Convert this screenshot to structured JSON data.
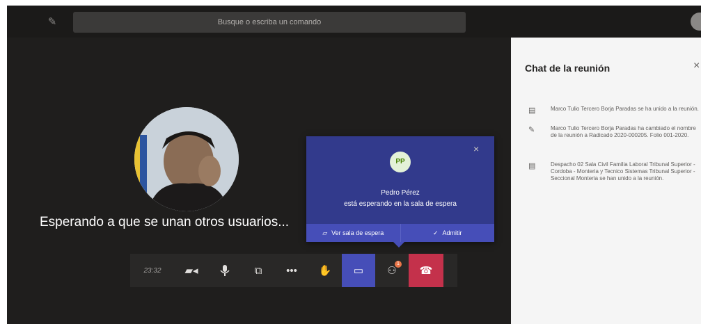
{
  "header": {
    "compose_icon": "compose-icon",
    "search_placeholder": "Busque o escriba un comando"
  },
  "stage": {
    "waiting_text": "Esperando a que se unan otros usuarios..."
  },
  "chat": {
    "title": "Chat de la reunión",
    "close_icon": "×",
    "messages": [
      {
        "icon": "people-icon",
        "text": "Marco Tulio Tercero Borja Paradas se ha unido a la reunión."
      },
      {
        "icon": "pencil-icon",
        "text": "Marco Tulio Tercero Borja Paradas ha cambiado el nombre de la reunión a Radicado 2020-000205. Folio 001-2020."
      },
      {
        "icon": "people-icon",
        "text": "Despacho 02 Sala Civil Familia Laboral Tribunal Superior - Cordoba - Monteria y Tecnico Sistemas Tribunal Superior - Seccional Monteria se han unido a la reunión."
      }
    ]
  },
  "lobby_popup": {
    "initials": "PP",
    "name": "Pedro Pérez",
    "status": "está esperando en la sala de espera",
    "view_lobby_label": "Ver sala de espera",
    "admit_label": "Admitir",
    "close_icon": "×"
  },
  "toolbar": {
    "timer": "23:32",
    "participants_badge": "1"
  },
  "colors": {
    "popup_bg": "#323a8c",
    "accent": "#464eb8",
    "hangup": "#c4314b"
  }
}
